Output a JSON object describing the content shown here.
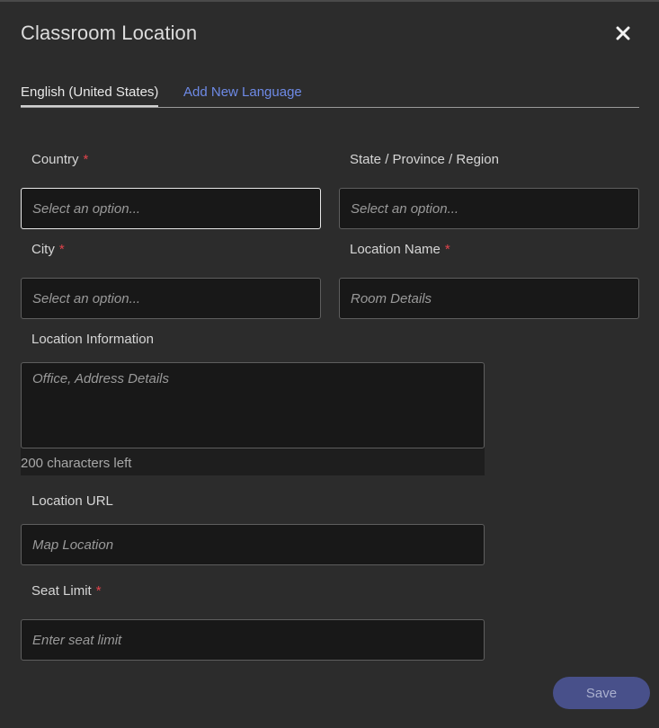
{
  "dialog": {
    "title": "Classroom Location"
  },
  "tabs": {
    "active_label": "English (United States)",
    "add_label": "Add New Language"
  },
  "form": {
    "required_mark": "*",
    "country": {
      "label": "Country",
      "placeholder": "Select an option..."
    },
    "state": {
      "label": "State / Province / Region",
      "placeholder": "Select an option..."
    },
    "city": {
      "label": "City",
      "placeholder": "Select an option..."
    },
    "location_name": {
      "label": "Location Name",
      "placeholder": "Room Details"
    },
    "location_info": {
      "label": "Location Information",
      "placeholder": "Office, Address Details",
      "chars_left": "200 characters left"
    },
    "location_url": {
      "label": "Location URL",
      "placeholder": "Map Location"
    },
    "seat_limit": {
      "label": "Seat Limit",
      "placeholder": "Enter seat limit"
    }
  },
  "actions": {
    "save_label": "Save"
  },
  "colors": {
    "background": "#2c2c2c",
    "accent_link": "#6e8ae6",
    "required": "#e0434b",
    "save_button": "#48508a"
  }
}
